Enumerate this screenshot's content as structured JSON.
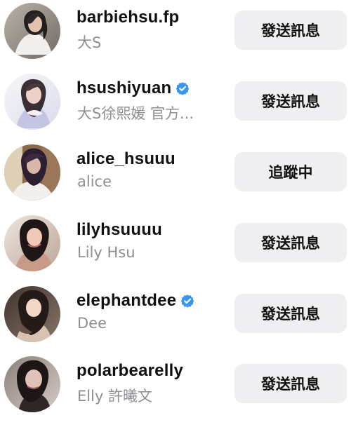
{
  "accounts": [
    {
      "username": "barbiehsu.fp",
      "display_name": "大S",
      "verified": false,
      "action_label": "發送訊息",
      "avatar_icon": "portrait-avatar"
    },
    {
      "username": "hsushiyuan",
      "display_name": "大S徐熙媛 官方...",
      "verified": true,
      "action_label": "發送訊息",
      "avatar_icon": "portrait-avatar"
    },
    {
      "username": "alice_hsuuu",
      "display_name": "alice",
      "verified": false,
      "action_label": "追蹤中",
      "avatar_icon": "portrait-avatar"
    },
    {
      "username": "lilyhsuuuu",
      "display_name": "Lily Hsu",
      "verified": false,
      "action_label": "發送訊息",
      "avatar_icon": "portrait-avatar"
    },
    {
      "username": "elephantdee",
      "display_name": "Dee",
      "verified": true,
      "action_label": "發送訊息",
      "avatar_icon": "portrait-avatar"
    },
    {
      "username": "polarbearelly",
      "display_name": "Elly 許曦文",
      "verified": false,
      "action_label": "發送訊息",
      "avatar_icon": "portrait-avatar"
    }
  ],
  "colors": {
    "username": "#111111",
    "secondary_text": "#8e8e93",
    "button_bg": "#efeff1",
    "verified_blue": "#3897f0"
  },
  "icons": {
    "verified": "verified-badge-icon"
  }
}
